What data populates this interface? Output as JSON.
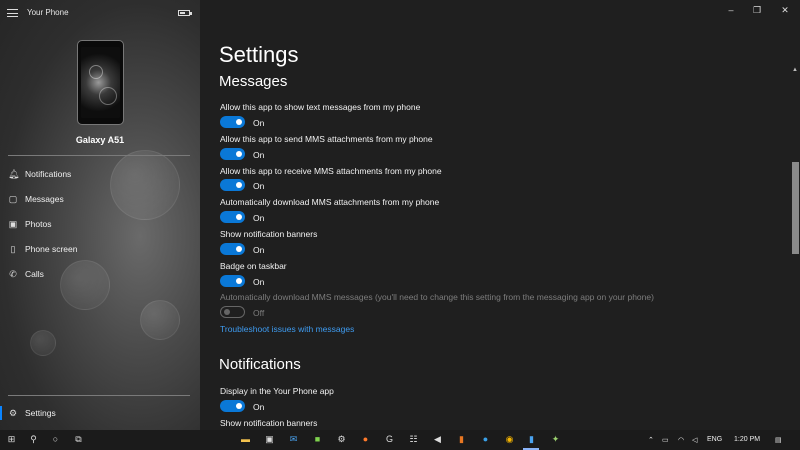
{
  "app": {
    "title": "Your Phone"
  },
  "device": {
    "name": "Galaxy A51"
  },
  "sidebar": {
    "items": [
      {
        "label": "Notifications",
        "icon": "bell-icon"
      },
      {
        "label": "Messages",
        "icon": "messages-icon"
      },
      {
        "label": "Photos",
        "icon": "photos-icon"
      },
      {
        "label": "Phone screen",
        "icon": "phone-screen-icon"
      },
      {
        "label": "Calls",
        "icon": "calls-icon"
      }
    ],
    "settings_label": "Settings"
  },
  "settings": {
    "title": "Settings",
    "messages": {
      "heading": "Messages",
      "items": [
        {
          "label": "Allow this app to show text messages from my phone",
          "state": "On"
        },
        {
          "label": "Allow this app to send MMS attachments from my phone",
          "state": "On"
        },
        {
          "label": "Allow this app to receive MMS attachments from my phone",
          "state": "On"
        },
        {
          "label": "Automatically download MMS attachments from my phone",
          "state": "On"
        },
        {
          "label": "Show notification banners",
          "state": "On"
        },
        {
          "label": "Badge on taskbar",
          "state": "On"
        },
        {
          "label": "Automatically download MMS messages (you'll need to change this setting from the messaging app on your phone)",
          "state": "Off"
        }
      ],
      "troubleshoot_link": "Troubleshoot issues with messages"
    },
    "notifications": {
      "heading": "Notifications",
      "items": [
        {
          "label": "Display in the Your Phone app",
          "state": "On"
        },
        {
          "label": "Show notification banners"
        }
      ]
    }
  },
  "taskbar": {
    "language": "ENG",
    "time": "1:20 PM"
  },
  "colors": {
    "accent": "#0a78d7",
    "link": "#3e9bf0",
    "background": "#1f1f1f"
  }
}
